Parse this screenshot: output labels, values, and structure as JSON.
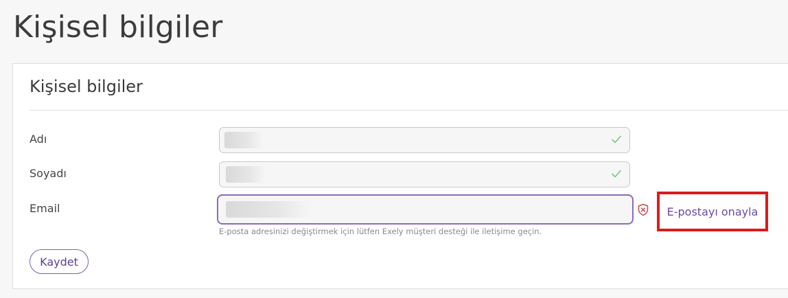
{
  "page": {
    "title": "Kişisel bilgiler"
  },
  "card": {
    "title": "Kişisel bilgiler",
    "fields": [
      {
        "label": "Adı",
        "value": "",
        "status_icon": "check-icon"
      },
      {
        "label": "Soyadı",
        "value": "",
        "status_icon": "check-icon"
      },
      {
        "label": "Email",
        "value": "",
        "status_icon": "shield-x-icon"
      }
    ],
    "email_helper": "E-posta adresinizi değiştirmek için lütfen Exely müşteri desteği ile iletişime geçin.",
    "verify_email_label": "E-postayı onayla",
    "save_label": "Kaydet"
  },
  "colors": {
    "accent": "#6a4aa2",
    "valid": "#7cc47c",
    "error": "#c9474d",
    "highlight": "#dd1a1a"
  }
}
